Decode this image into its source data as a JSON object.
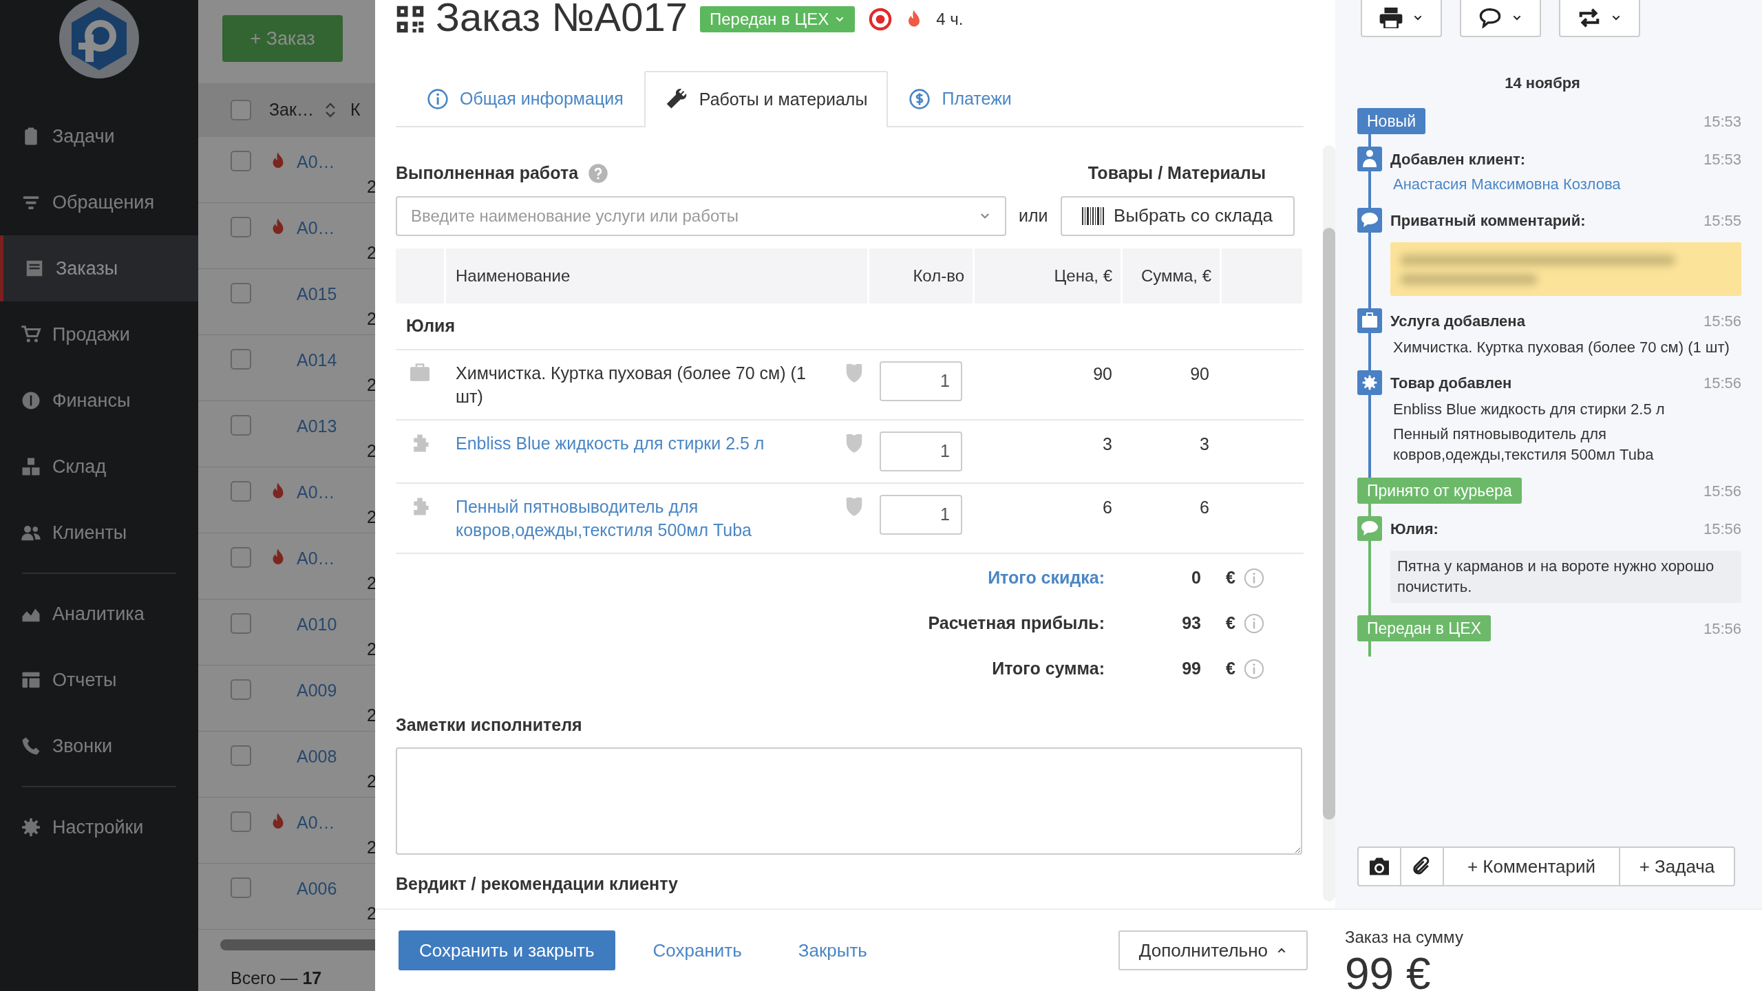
{
  "sidebar": {
    "groups": [
      [
        {
          "label": "Задачи",
          "selected": false
        },
        {
          "label": "Обращения",
          "selected": false
        },
        {
          "label": "Заказы",
          "selected": true
        },
        {
          "label": "Продажи",
          "selected": false
        },
        {
          "label": "Финансы",
          "selected": false
        },
        {
          "label": "Склад",
          "selected": false
        },
        {
          "label": "Клиенты",
          "selected": false
        }
      ],
      [
        {
          "label": "Аналитика",
          "selected": false
        },
        {
          "label": "Отчеты",
          "selected": false
        },
        {
          "label": "Звонки",
          "selected": false
        }
      ],
      [
        {
          "label": "Настройки",
          "selected": false
        }
      ]
    ]
  },
  "order_list": {
    "new_button": "+ Заказ",
    "header_checked": false,
    "columns": [
      "Зак…",
      "К"
    ],
    "rows": [
      {
        "number": "A0…",
        "urgent": true,
        "checked": false,
        "column_3": "2"
      },
      {
        "number": "A0…",
        "urgent": true,
        "checked": false,
        "column_3": "2"
      },
      {
        "number": "A015",
        "urgent": false,
        "checked": false,
        "column_3": "2"
      },
      {
        "number": "A014",
        "urgent": false,
        "checked": false,
        "column_3": "2"
      },
      {
        "number": "A013",
        "urgent": false,
        "checked": false,
        "column_3": "2"
      },
      {
        "number": "A0…",
        "urgent": true,
        "checked": false,
        "column_3": "2"
      },
      {
        "number": "A0…",
        "urgent": true,
        "checked": false,
        "column_3": "2"
      },
      {
        "number": "A010",
        "urgent": false,
        "checked": false,
        "column_3": "2"
      },
      {
        "number": "A009",
        "urgent": false,
        "checked": false,
        "column_3": "2"
      },
      {
        "number": "A008",
        "urgent": false,
        "checked": false,
        "column_3": "2"
      },
      {
        "number": "A0…",
        "urgent": true,
        "checked": false,
        "column_3": "2"
      },
      {
        "number": "A006",
        "urgent": false,
        "checked": false,
        "column_3": "2"
      }
    ],
    "total": "Всего — **17**"
  },
  "order": {
    "title": "Заказ №A017",
    "status": "Передан в ЦЕХ",
    "urgent": true,
    "timer": "4 ч."
  },
  "tabs": [
    {
      "label": "Общая информация",
      "selected": false
    },
    {
      "label": "Работы и материалы",
      "selected": true
    },
    {
      "label": "Платежи",
      "selected": false
    }
  ],
  "work": {
    "label": "Выполненная работа",
    "placeholder": "Введите наименование услуги или работы",
    "or": "или",
    "goods_label": "Товары / Материалы",
    "stock_button": "Выбрать со склада"
  },
  "table": {
    "columns": [
      "Наименование",
      "Кол-во",
      "Цена, €",
      "Сумма, €"
    ],
    "group": "Юлия",
    "rows": [
      {
        "kind": "service",
        "name": "Химчистка. Куртка пуховая (более 70 см) (1 шт)",
        "quantity": "1",
        "price": "90",
        "sum": "90"
      },
      {
        "kind": "product",
        "name": "Enbliss Blue жидкость для стирки 2.5 л",
        "quantity": "1",
        "price": "3",
        "sum": "3"
      },
      {
        "kind": "product",
        "name": "Пенный пятновыводитель для ковров,одежды,текстиля 500мл Tuba",
        "quantity": "1",
        "price": "6",
        "sum": "6"
      }
    ]
  },
  "totals": [
    {
      "label": "Итого скидка:",
      "value": "0",
      "currency": "€",
      "link": true
    },
    {
      "label": "Расчетная прибыль:",
      "value": "93",
      "currency": "€",
      "link": false
    },
    {
      "label": "Итого сумма:",
      "value": "99",
      "currency": "€",
      "link": false
    }
  ],
  "notes": {
    "label": "Заметки исполнителя"
  },
  "verdict": {
    "label": "Вердикт / рекомендации клиенту"
  },
  "footer": {
    "save_close": "Сохранить и закрыть",
    "save": "Сохранить",
    "close": "Закрыть",
    "more": "Дополнительно"
  },
  "history": {
    "date": "14 ноября",
    "events": [
      {
        "kind": "status",
        "label": "Новый",
        "time": "15:53",
        "color": "#4a80c4"
      },
      {
        "kind": "client",
        "title": "Добавлен клиент:",
        "link": "Анастасия Максимовна Козлова",
        "time": "15:53",
        "color": "#4a80c4"
      },
      {
        "kind": "private_comment",
        "title": "Приватный комментарий:",
        "time": "15:55",
        "color": "#4a80c4"
      },
      {
        "kind": "service",
        "title": "Услуга добавлена",
        "details": [
          "Химчистка. Куртка пуховая (более 70 см) (1 шт)"
        ],
        "time": "15:56",
        "color": "#4a80c4"
      },
      {
        "kind": "product",
        "title": "Товар добавлен",
        "details": [
          "Enbliss Blue жидкость для стирки 2.5 л",
          "Пенный пятновыводитель для ковров,одежды,текстиля 500мл Tuba"
        ],
        "time": "15:56",
        "color": "#4a80c4"
      },
      {
        "kind": "status",
        "label": "Принято от курьера",
        "time": "15:56",
        "color": "#6cb96a"
      },
      {
        "kind": "comment",
        "title": "Юлия:",
        "text": "Пятна у карманов и на вороте нужно хорошо почистить.",
        "time": "15:56",
        "color": "#6cb96a"
      },
      {
        "kind": "status",
        "label": "Передан в ЦЕХ",
        "time": "15:56",
        "color": "#6cb96a"
      }
    ]
  },
  "actions": {
    "comment": "+ Комментарий",
    "task": "+ Задача"
  },
  "summary": {
    "label": "Заказ на сумму",
    "amount": "99 €"
  }
}
